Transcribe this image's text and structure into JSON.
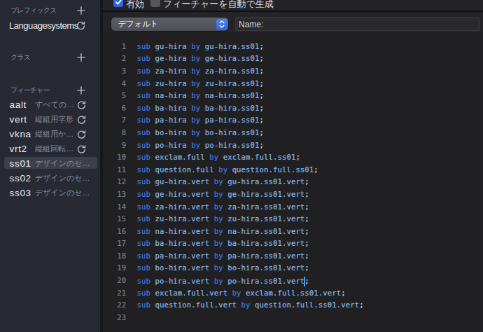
{
  "colors": {
    "sidebar_bg": "#272933",
    "editor_bg": "#202023",
    "panel_bg": "#242428",
    "accent_blue": "#2f68e2",
    "keyword_blue": "#4478d9",
    "glyphname_blue": "#89bae7",
    "selection_gray": "#3e4048",
    "caret_blue": "#3e9efb"
  },
  "icons": {
    "plus": "plus-icon",
    "refresh": "refresh-circular-arrow-icon",
    "checkmark": "checkmark-icon",
    "popup_chevrons": "up-down-chevrons-icon"
  },
  "sidebar": {
    "prefix_section": {
      "title": "プレフィックス",
      "items": [
        {
          "name": "Languagesystems",
          "desc": "",
          "auto": true,
          "selected": false
        }
      ]
    },
    "class_section": {
      "title": "クラス",
      "items": []
    },
    "feature_section": {
      "title": "フィーチャー",
      "items": [
        {
          "name": "aalt",
          "desc": "すべての…",
          "auto": true,
          "selected": false
        },
        {
          "name": "vert",
          "desc": "縦組用字形",
          "auto": true,
          "selected": false
        },
        {
          "name": "vkna",
          "desc": "縦組用か…",
          "auto": true,
          "selected": false
        },
        {
          "name": "vrt2",
          "desc": "縦組回転…",
          "auto": true,
          "selected": false
        },
        {
          "name": "ss01",
          "desc": "デザインのセ…",
          "auto": false,
          "selected": true
        },
        {
          "name": "ss02",
          "desc": "デザインのセ…",
          "auto": false,
          "selected": false
        },
        {
          "name": "ss03",
          "desc": "デザインのセ…",
          "auto": false,
          "selected": false
        }
      ]
    }
  },
  "toolbar": {
    "enabled_label": "有効",
    "enabled_checked": true,
    "auto_generate_label": "フィーチャーを自動で生成",
    "auto_generate_checked": false
  },
  "controls": {
    "popup_selected": "デフォルト",
    "name_label": "Name:",
    "name_value": ""
  },
  "editor": {
    "keywords": [
      "sub",
      "by"
    ],
    "caret": {
      "line": 20,
      "before_trailing_semicolon": true
    },
    "lines": [
      "sub gu-hira by gu-hira.ss01;",
      "sub ge-hira by ge-hira.ss01;",
      "sub za-hira by za-hira.ss01;",
      "sub zu-hira by zu-hira.ss01;",
      "sub na-hira by na-hira.ss01;",
      "sub ba-hira by ba-hira.ss01;",
      "sub pa-hira by pa-hira.ss01;",
      "sub bo-hira by bo-hira.ss01;",
      "sub po-hira by po-hira.ss01;",
      "sub exclam.full by exclam.full.ss01;",
      "sub question.full by question.full.ss01;",
      "sub gu-hira.vert by gu-hira.ss01.vert;",
      "sub ge-hira.vert by ge-hira.ss01.vert;",
      "sub za-hira.vert by za-hira.ss01.vert;",
      "sub zu-hira.vert by zu-hira.ss01.vert;",
      "sub na-hira.vert by na-hira.ss01.vert;",
      "sub ba-hira.vert by ba-hira.ss01.vert;",
      "sub pa-hira.vert by pa-hira.ss01.vert;",
      "sub bo-hira.vert by bo-hira.ss01.vert;",
      "sub po-hira.vert by po-hira.ss01.vert;",
      "sub exclam.full.vert by exclam.full.ss01.vert;",
      "sub question.full.vert by question.full.ss01.vert;",
      ""
    ]
  }
}
